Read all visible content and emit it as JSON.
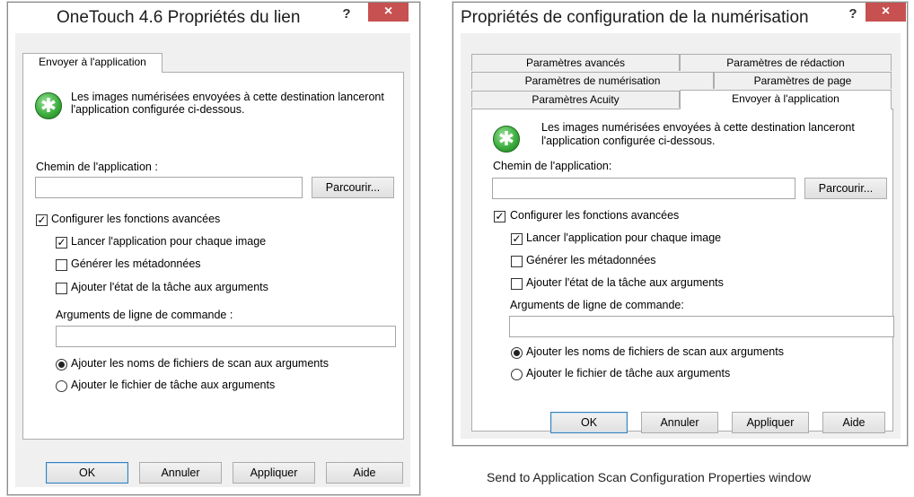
{
  "left_window": {
    "title": "OneTouch 4.6 Propriétés du lien",
    "help": "?",
    "close": "×",
    "tab": "Envoyer à l'application",
    "description": "Les images numérisées envoyées à cette destination lanceront l'application configurée ci-dessous.",
    "path_label": "Chemin de l'application :",
    "path_value": "",
    "browse": "Parcourir...",
    "advanced": {
      "label": "Configurer les fonctions avancées",
      "checked": true
    },
    "launch_each": {
      "label": "Lancer l'application pour chaque image",
      "checked": true
    },
    "metadata": {
      "label": "Générer les métadonnées",
      "checked": false
    },
    "job_state": {
      "label": "Ajouter l'état de la tâche aux arguments",
      "checked": false
    },
    "args_label": "Arguments de ligne de commande :",
    "args_value": "",
    "radio_filenames": {
      "label": "Ajouter les noms de fichiers de scan aux arguments",
      "selected": true
    },
    "radio_jobfile": {
      "label": "Ajouter le fichier de tâche aux arguments",
      "selected": false
    },
    "buttons": {
      "ok": "OK",
      "cancel": "Annuler",
      "apply": "Appliquer",
      "help": "Aide"
    }
  },
  "right_window": {
    "title": "Propriétés de configuration de la numérisation",
    "help": "?",
    "close": "×",
    "tabs": {
      "advanced": "Paramètres avancés",
      "redaction": "Paramètres de rédaction",
      "scan": "Paramètres de numérisation",
      "page": "Paramètres de page",
      "acuity": "Paramètres Acuity",
      "send": "Envoyer à l'application"
    },
    "description": "Les images numérisées envoyées à cette destination lanceront l'application configurée ci-dessous.",
    "path_label": "Chemin de l'application:",
    "path_value": "",
    "browse": "Parcourir...",
    "advanced": {
      "label": "Configurer les fonctions avancées",
      "checked": true
    },
    "launch_each": {
      "label": "Lancer l'application pour chaque image",
      "checked": true
    },
    "metadata": {
      "label": "Générer les métadonnées",
      "checked": false
    },
    "job_state": {
      "label": "Ajouter l'état de la tâche aux arguments",
      "checked": false
    },
    "args_label": "Arguments de ligne de commande:",
    "args_value": "",
    "radio_filenames": {
      "label": "Ajouter les noms de fichiers de scan aux arguments",
      "selected": true
    },
    "radio_jobfile": {
      "label": "Ajouter le fichier de tâche aux arguments",
      "selected": false
    },
    "buttons": {
      "ok": "OK",
      "cancel": "Annuler",
      "apply": "Appliquer",
      "help": "Aide"
    }
  },
  "caption": "Send to Application Scan Configuration Properties window",
  "colors": {
    "close_button": "#c75050",
    "icon_green": "#3fae3f",
    "client_bg": "#f0f0f0"
  },
  "icons": {
    "app": "green-star-icon"
  }
}
